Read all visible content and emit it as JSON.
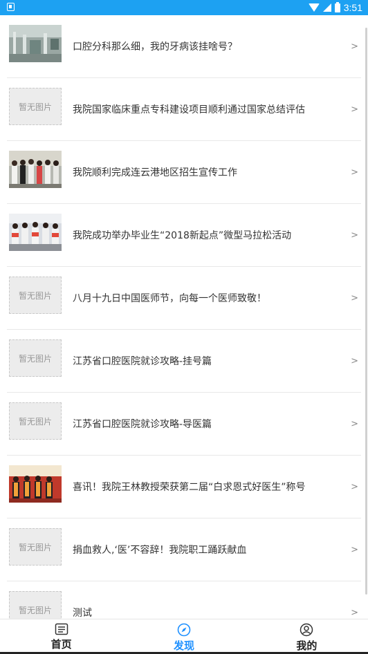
{
  "status_bar": {
    "time": "3:51"
  },
  "articles": [
    {
      "title": "口腔分科那么细，我的牙病该挂啥号？",
      "thumb": "photo-hall"
    },
    {
      "title": "我院国家临床重点专科建设项目顺利通过国家总结评估",
      "thumb": "none"
    },
    {
      "title": "我院顺利完成连云港地区招生宣传工作",
      "thumb": "photo-group"
    },
    {
      "title": "我院成功举办毕业生“2018新起点”微型马拉松活动",
      "thumb": "photo-runners"
    },
    {
      "title": "八月十九日中国医师节，向每一个医师致敬！",
      "thumb": "none"
    },
    {
      "title": "江苏省口腔医院就诊攻略-挂号篇",
      "thumb": "none"
    },
    {
      "title": "江苏省口腔医院就诊攻略-导医篇",
      "thumb": "none"
    },
    {
      "title": "喜讯！我院王林教授荣获第二届“白求恩式好医生”称号",
      "thumb": "photo-award"
    },
    {
      "title": "捐血救人,‘医’不容辞！我院职工踊跃献血",
      "thumb": "none"
    },
    {
      "title": "测试",
      "thumb": "none"
    }
  ],
  "placeholder_text": "暂无图片",
  "arrow_glyph": ">",
  "tabbar": {
    "tabs": [
      {
        "label": "首页",
        "icon": "news-icon",
        "active": false
      },
      {
        "label": "发现",
        "icon": "compass-icon",
        "active": true
      },
      {
        "label": "我的",
        "icon": "user-icon",
        "active": false
      }
    ]
  },
  "colors": {
    "status_bar": "#1da1f2",
    "accent": "#1e90ff"
  }
}
